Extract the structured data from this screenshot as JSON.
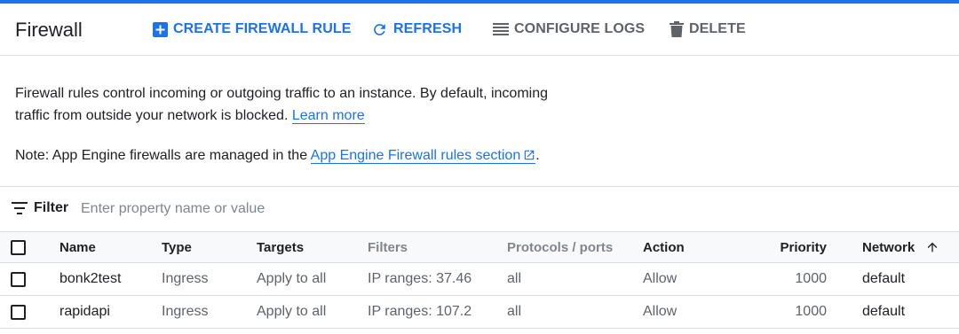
{
  "header": {
    "title": "Firewall",
    "actions": [
      {
        "label": "CREATE FIREWALL RULE",
        "icon": "add-box-icon",
        "color": "#1a73e8"
      },
      {
        "label": "REFRESH",
        "icon": "refresh-icon",
        "color": "#1a73e8"
      },
      {
        "label": "CONFIGURE LOGS",
        "icon": "list-icon",
        "color": "#5f6368"
      },
      {
        "label": "DELETE",
        "icon": "trash-icon",
        "color": "#5f6368"
      }
    ]
  },
  "info": {
    "text": "Firewall rules control incoming or outgoing traffic to an instance. By default, incoming traffic from outside your network is blocked.",
    "learn_more": "Learn more"
  },
  "note": {
    "prefix": "Note: App Engine firewalls are managed in the",
    "link": "App Engine Firewall rules section",
    "suffix": "."
  },
  "filter": {
    "label": "Filter",
    "placeholder": "Enter property name or value"
  },
  "table": {
    "columns": [
      "Name",
      "Type",
      "Targets",
      "Filters",
      "Protocols / ports",
      "Action",
      "Priority",
      "Network"
    ],
    "sort_column": "Network",
    "sort_direction": "ascending",
    "rows": [
      {
        "name": "bonk2test",
        "type": "Ingress",
        "targets": "Apply to all",
        "filters": "IP ranges: 37.46",
        "protocols": "all",
        "action": "Allow",
        "priority": "1000",
        "network": "default"
      },
      {
        "name": "rapidapi",
        "type": "Ingress",
        "targets": "Apply to all",
        "filters": "IP ranges: 107.2",
        "protocols": "all",
        "action": "Allow",
        "priority": "1000",
        "network": "default"
      }
    ]
  }
}
